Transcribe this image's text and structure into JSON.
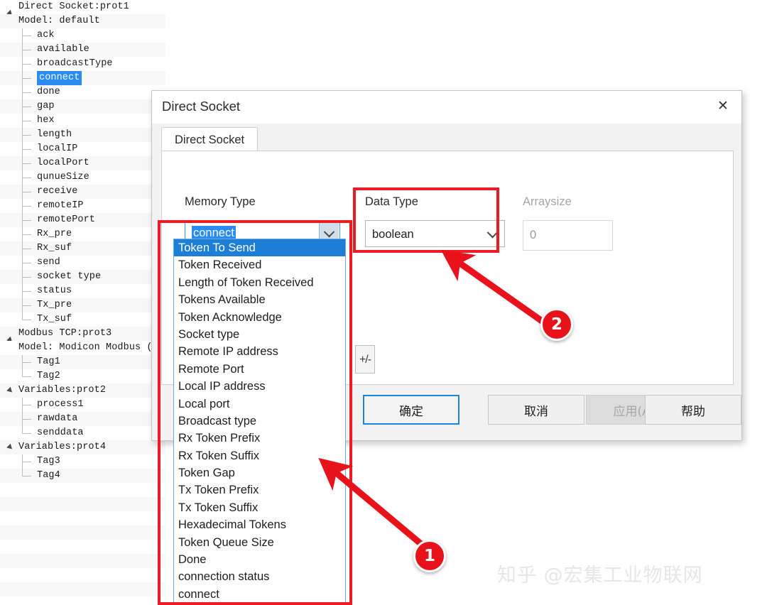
{
  "tree": {
    "groups": [
      {
        "title": "Direct Socket:prot1",
        "subtitle": "Model: default",
        "children": [
          "ack",
          "available",
          "broadcastType",
          "connect",
          "done",
          "gap",
          "hex",
          "length",
          "localIP",
          "localPort",
          "qunueSize",
          "receive",
          "remoteIP",
          "remotePort",
          "Rx_pre",
          "Rx_suf",
          "send",
          "socket type",
          "status",
          "Tx_pre",
          "Tx_suf"
        ],
        "selected": "connect"
      },
      {
        "title": "Modbus TCP:prot3",
        "subtitle": "Model: Modicon Modbus (",
        "children": [
          "Tag1",
          "Tag2"
        ],
        "selected": null
      },
      {
        "title": "Variables:prot2",
        "subtitle": null,
        "children": [
          "process1",
          "rawdata",
          "senddata"
        ],
        "selected": null
      },
      {
        "title": "Variables:prot4",
        "subtitle": null,
        "children": [
          "Tag3",
          "Tag4"
        ],
        "selected": null
      }
    ]
  },
  "dialog": {
    "title": "Direct Socket",
    "close_label": "✕",
    "tab_label": "Direct Socket",
    "fields": {
      "memory_type_label": "Memory Type",
      "memory_type_value": "connect",
      "data_type_label": "Data Type",
      "data_type_value": "boolean",
      "arraysize_label": "Arraysize",
      "arraysize_value": "0",
      "plusminus_label": "+/-"
    },
    "dropdown": {
      "highlighted": "Token To Send",
      "items": [
        "Token To Send",
        "Token Received",
        "Length of Token Received",
        "Tokens Available",
        "Token Acknowledge",
        "Socket type",
        "Remote IP address",
        "Remote Port",
        "Local IP address",
        "Local port",
        "Broadcast type",
        "Rx Token Prefix",
        "Rx Token Suffix",
        "Token Gap",
        "Tx Token Prefix",
        "Tx Token Suffix",
        "Hexadecimal Tokens",
        "Token Queue Size",
        "Done",
        "connection status",
        "connect"
      ]
    },
    "buttons": {
      "ok": "确定",
      "cancel": "取消",
      "apply": "应用(A)",
      "help": "帮助"
    }
  },
  "annotations": {
    "badge_1": "1",
    "badge_2": "2",
    "accent_color": "#ed1c24"
  },
  "watermark": {
    "text": "知乎 @宏集工业物联网"
  }
}
